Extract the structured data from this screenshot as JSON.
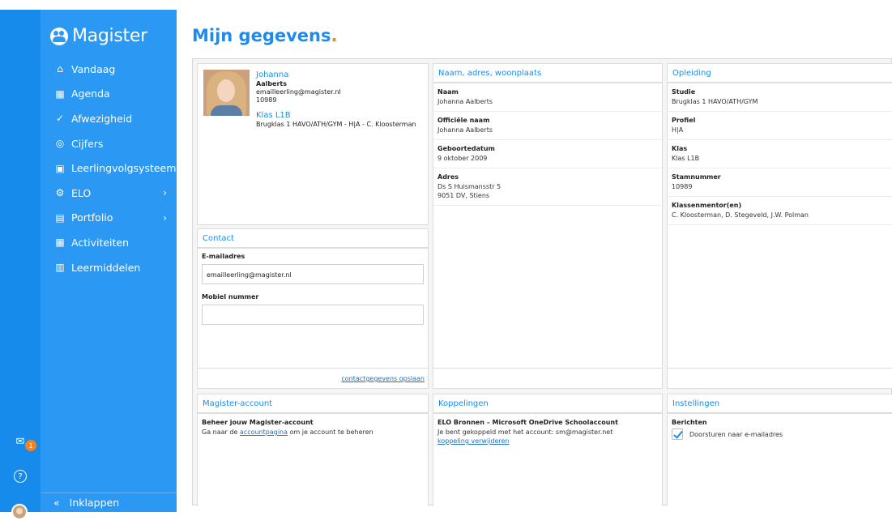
{
  "app": {
    "name": "Magister"
  },
  "nav": [
    {
      "label": "Vandaag",
      "icon": "home-icon",
      "glyph": "⌂",
      "chevron": false
    },
    {
      "label": "Agenda",
      "icon": "calendar-icon",
      "glyph": "▦",
      "chevron": false
    },
    {
      "label": "Afwezigheid",
      "icon": "check-circle-icon",
      "glyph": "✓",
      "chevron": false
    },
    {
      "label": "Cijfers",
      "icon": "grade-icon",
      "glyph": "◎",
      "chevron": false
    },
    {
      "label": "Leerlingvolgsysteem",
      "icon": "profile-card-icon",
      "glyph": "▣",
      "chevron": false
    },
    {
      "label": "ELO",
      "icon": "elo-icon",
      "glyph": "⚙",
      "chevron": true
    },
    {
      "label": "Portfolio",
      "icon": "portfolio-icon",
      "glyph": "▤",
      "chevron": true
    },
    {
      "label": "Activiteiten",
      "icon": "calendar-star-icon",
      "glyph": "▦",
      "chevron": false
    },
    {
      "label": "Leermiddelen",
      "icon": "books-icon",
      "glyph": "▥",
      "chevron": false
    }
  ],
  "collapse_label": "Inklappen",
  "mail_badge": "1",
  "page_title": "Mijn gegevens",
  "profile": {
    "first_name": "Johanna",
    "last_name": "Aalberts",
    "email": "emailleerling@magister.nl",
    "number": "10989",
    "class_title": "Klas L1B",
    "class_detail": "Brugklas 1 HAVO/ATH/GYM - H|A - C. Kloosterman"
  },
  "contact": {
    "title": "Contact",
    "email_label": "E-mailadres",
    "email_value": "emailleerling@magister.nl",
    "mobile_label": "Mobiel nummer",
    "mobile_value": "",
    "save_link": "contactgegevens opslaan"
  },
  "naw": {
    "title": "Naam, adres, woonplaats",
    "fields": [
      {
        "label": "Naam",
        "lines": [
          "Johanna Aalberts"
        ]
      },
      {
        "label": "Officiële naam",
        "lines": [
          "Johanna Aalberts"
        ]
      },
      {
        "label": "Geboortedatum",
        "lines": [
          "9 oktober 2009"
        ]
      },
      {
        "label": "Adres",
        "lines": [
          "Ds S Huismansstr 5",
          "9051 DV, Stiens"
        ]
      }
    ]
  },
  "opleiding": {
    "title": "Opleiding",
    "fields": [
      {
        "label": "Studie",
        "lines": [
          "Brugklas 1 HAVO/ATH/GYM"
        ]
      },
      {
        "label": "Profiel",
        "lines": [
          "H|A"
        ]
      },
      {
        "label": "Klas",
        "lines": [
          "Klas L1B"
        ]
      },
      {
        "label": "Stamnummer",
        "lines": [
          "10989"
        ]
      },
      {
        "label": "Klassenmentor(en)",
        "lines": [
          "C. Kloosterman,  D. Stegeveld,  J.W. Polman"
        ]
      }
    ]
  },
  "account": {
    "title": "Magister-account",
    "heading": "Beheer jouw Magister-account",
    "text_before": "Ga naar de ",
    "link": "accountpagina",
    "text_after": " om je account te beheren"
  },
  "koppelingen": {
    "title": "Koppelingen",
    "heading": "ELO Bronnen – Microsoft OneDrive Schoolaccount",
    "text": "Je bent gekoppeld met het account: sm@magister.net",
    "link": "koppeling verwijderen"
  },
  "instellingen": {
    "title": "Instellingen",
    "heading": "Berichten",
    "checkbox_label": "Doorsturen naar e-mailadres",
    "checked": true
  },
  "colors": {
    "brand": "#1e8be8",
    "sidebar": "#2b98f3",
    "rail": "#168bec",
    "accent": "#f5821f"
  }
}
